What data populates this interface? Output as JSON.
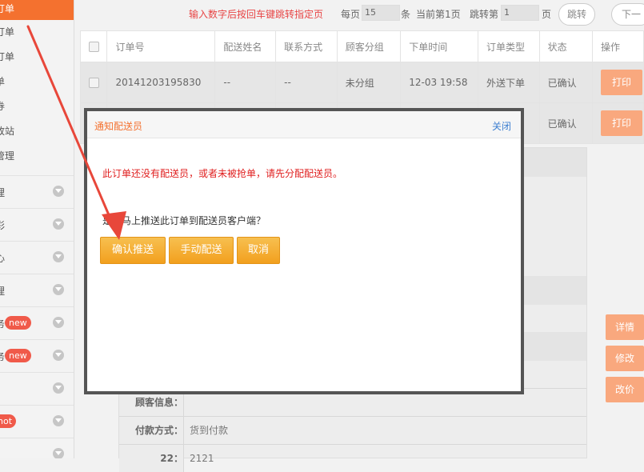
{
  "sidebar": {
    "active_label": "订单",
    "sub_items": [
      "订单",
      "订单",
      "单",
      "券",
      "改站",
      "管理"
    ],
    "main_items": [
      {
        "label": "理",
        "badge": ""
      },
      {
        "label": "彩",
        "badge": ""
      },
      {
        "label": "心",
        "badge": ""
      },
      {
        "label": "理",
        "badge": ""
      },
      {
        "label": "务",
        "badge": "new"
      },
      {
        "label": "务",
        "badge": "new"
      },
      {
        "label": "",
        "badge": ""
      },
      {
        "label": "",
        "badge": "hot"
      },
      {
        "label": "",
        "badge": ""
      }
    ]
  },
  "pager": {
    "hint": "输入数字后按回车键跳转指定页",
    "per_page_label": "每页",
    "per_page_value": "15",
    "unit": "条",
    "current": "当前第1页",
    "jump_label": "跳转第",
    "jump_value": "1",
    "page_unit": "页",
    "jump_button": "跳转",
    "next_button": "下一"
  },
  "table": {
    "headers": [
      "订单号",
      "配送姓名",
      "联系方式",
      "顾客分组",
      "下单时间",
      "订单类型",
      "状态",
      "操作"
    ],
    "rows": [
      {
        "order": "20141203195830",
        "name": "--",
        "contact": "--",
        "group": "未分组",
        "time": "12-03 19:58",
        "type": "外送下单",
        "status": "已确认",
        "action": "打印"
      },
      {
        "order": "",
        "name": "",
        "contact": "",
        "group": "",
        "time": "",
        "type": "单",
        "status": "已确认",
        "action": "打印"
      }
    ]
  },
  "detail": {
    "rows": [
      {
        "key": "顾客信息：",
        "value": ""
      },
      {
        "key": "付款方式：",
        "value": "货到付款"
      },
      {
        "key": "22：",
        "value": "2121"
      }
    ]
  },
  "side_buttons": [
    "详情",
    "修改",
    "改价"
  ],
  "modal": {
    "title": "通知配送员",
    "close": "关闭",
    "message": "此订单还没有配送员，或者未被抢单，请先分配配送员。",
    "question": "是否马上推送此订单到配送员客户端？",
    "buttons": [
      "确认推送",
      "手动配送",
      "取消"
    ]
  },
  "colors": {
    "accent": "#f4712f",
    "button": "#f2a01e",
    "arrow": "#e8473a"
  }
}
